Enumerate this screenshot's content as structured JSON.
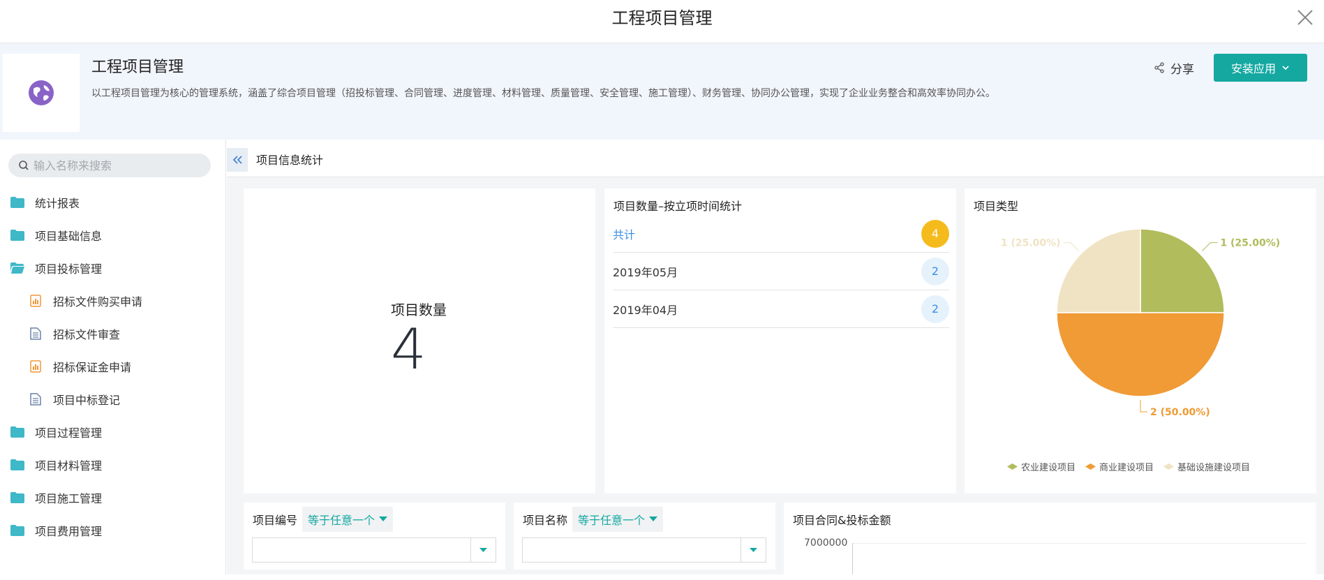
{
  "window": {
    "title": "工程项目管理"
  },
  "app": {
    "name": "工程项目管理",
    "description": "以工程项目管理为核心的管理系统，涵盖了综合项目管理（招投标管理、合同管理、进度管理、材料管理、质量管理、安全管理、施工管理）、财务管理、协同办公管理，实现了企业业务整合和高效率协同办公。",
    "share_label": "分享",
    "install_label": "安装应用",
    "accent_color": "#14a8a0"
  },
  "sidebar": {
    "search_placeholder": "输入名称来搜索",
    "items": [
      {
        "label": "统计报表",
        "icon": "folder-icon"
      },
      {
        "label": "项目基础信息",
        "icon": "folder-icon"
      },
      {
        "label": "项目投标管理",
        "icon": "folder-open-icon"
      },
      {
        "label": "招标文件购买申请",
        "icon": "form-icon"
      },
      {
        "label": "招标文件审查",
        "icon": "document-icon"
      },
      {
        "label": "招标保证金申请",
        "icon": "form-icon"
      },
      {
        "label": "项目中标登记",
        "icon": "document-icon"
      },
      {
        "label": "项目过程管理",
        "icon": "folder-icon"
      },
      {
        "label": "项目材料管理",
        "icon": "folder-icon"
      },
      {
        "label": "项目施工管理",
        "icon": "folder-icon"
      },
      {
        "label": "项目费用管理",
        "icon": "folder-icon"
      }
    ]
  },
  "main": {
    "breadcrumb": "项目信息统计",
    "count_card": {
      "label": "项目数量",
      "value": "4"
    },
    "time_card": {
      "title": "项目数量–按立项时间统计",
      "total_label": "共计",
      "total_value": "4",
      "rows": [
        {
          "label": "2019年05月",
          "value": "2"
        },
        {
          "label": "2019年04月",
          "value": "2"
        }
      ]
    },
    "type_card": {
      "title": "项目类型"
    },
    "filter_code": {
      "label": "项目编号",
      "operator": "等于任意一个"
    },
    "filter_name": {
      "label": "项目名称",
      "operator": "等于任意一个"
    },
    "amount_card": {
      "title": "项目合同&投标金额",
      "y_tick": "7000000"
    }
  },
  "chart_data": {
    "type": "pie",
    "title": "项目类型",
    "series": [
      {
        "name": "农业建设项目",
        "value": 1,
        "label": "1 (25.00%)",
        "color": "#b1bc5c"
      },
      {
        "name": "商业建设项目",
        "value": 2,
        "label": "2 (50.00%)",
        "color": "#f09b35"
      },
      {
        "name": "基础设施建设项目",
        "value": 1,
        "label": "1 (25.00%)",
        "color": "#f0e3c4"
      }
    ],
    "legend": "bottom"
  }
}
